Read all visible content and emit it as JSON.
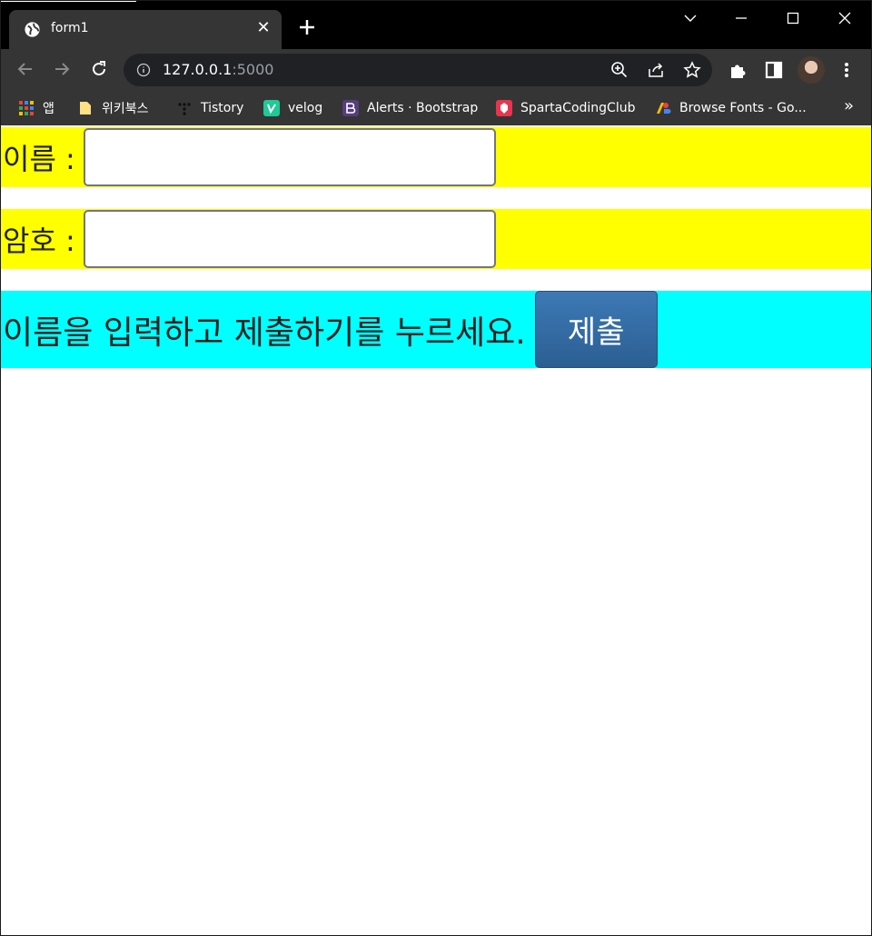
{
  "browser": {
    "tab": {
      "title": "form1",
      "close": "✕"
    },
    "new_tab": "+",
    "url": {
      "host": "127.0.0.1",
      "port": ":5000"
    },
    "bookmarks": [
      {
        "label": "앱",
        "icon": "apps-grid-icon"
      },
      {
        "label": "위키북스",
        "icon": "folder-icon"
      },
      {
        "label": "Tistory",
        "icon": "tistory-icon"
      },
      {
        "label": "velog",
        "icon": "velog-icon"
      },
      {
        "label": "Alerts · Bootstrap",
        "icon": "bootstrap-icon"
      },
      {
        "label": "SpartaCodingClub",
        "icon": "sparta-icon"
      },
      {
        "label": "Browse Fonts - Go...",
        "icon": "google-fonts-icon"
      }
    ],
    "bookmarks_more": "»"
  },
  "form": {
    "name_label": "이름 :",
    "name_value": "",
    "password_label": "암호 :",
    "password_value": "",
    "hint": "이름을 입력하고 제출하기를 누르세요.",
    "submit_label": "제출"
  },
  "colors": {
    "row_yellow": "#ffff00",
    "row_cyan": "#00ffff",
    "button": "#2f6aa3"
  }
}
